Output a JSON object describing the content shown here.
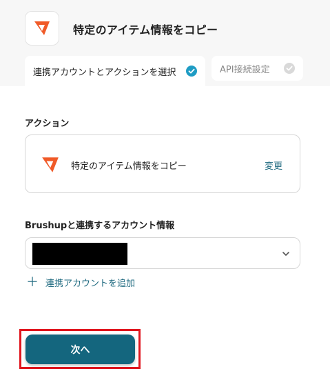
{
  "header": {
    "title": "特定のアイテム情報をコピー",
    "logo_icon": "brushup-logo-icon"
  },
  "tabs": [
    {
      "label": "連携アカウントとアクションを選択",
      "status": "completed",
      "active": true
    },
    {
      "label": "API接続設定",
      "status": "pending",
      "active": false
    }
  ],
  "action_section": {
    "label": "アクション",
    "card_text": "特定のアイテム情報をコピー",
    "change_label": "変更"
  },
  "account_section": {
    "label": "Brushupと連携するアカウント情報",
    "add_label": "連携アカウントを追加"
  },
  "footer": {
    "next_label": "次へ"
  },
  "colors": {
    "accent": "#14667e",
    "link": "#1f6a80",
    "check_active": "#1f9cc4",
    "highlight": "#e0161e",
    "logo_orange": "#f05a28"
  }
}
